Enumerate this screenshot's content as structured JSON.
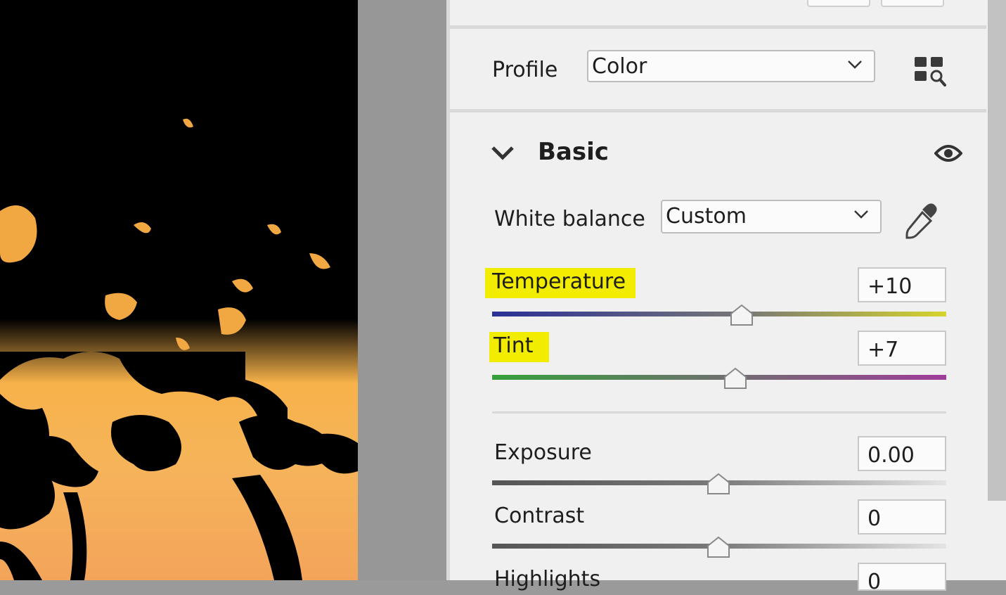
{
  "profile": {
    "label": "Profile",
    "value": "Color"
  },
  "basic": {
    "title": "Basic",
    "white_balance": {
      "label": "White balance",
      "value": "Custom"
    },
    "sliders": [
      {
        "label": "Temperature",
        "value": "+10",
        "highlighted": true,
        "level": 0.55
      },
      {
        "label": "Tint",
        "value": "+7",
        "highlighted": true,
        "level": 0.54
      },
      {
        "label": "Exposure",
        "value": "0.00",
        "highlighted": false,
        "level": 0.5
      },
      {
        "label": "Contrast",
        "value": "0",
        "highlighted": false,
        "level": 0.5
      },
      {
        "label": "Highlights",
        "value": "0",
        "highlighted": false,
        "level": 0.5
      }
    ]
  },
  "colors": {
    "highlight": "#f1ec00",
    "panel_bg": "#f0f0f0"
  },
  "icons": [
    "profile-browser-icon",
    "chevron-down-icon",
    "eye-icon",
    "eyedropper-icon"
  ]
}
